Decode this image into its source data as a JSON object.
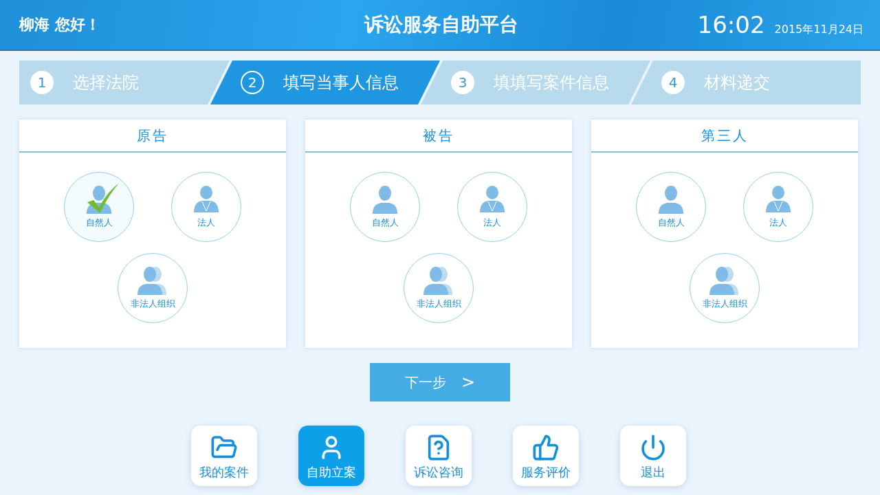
{
  "header": {
    "greeting": "柳海 您好！",
    "title": "诉讼服务自助平台",
    "time": "16:02",
    "date": "2015年11月24日"
  },
  "steps": [
    {
      "number": "1",
      "label": "选择法院",
      "selected": false
    },
    {
      "number": "2",
      "label": "填写当事人信息",
      "selected": true
    },
    {
      "number": "3",
      "label": "填填写案件信息",
      "selected": false
    },
    {
      "number": "4",
      "label": "材料递交",
      "selected": false
    }
  ],
  "parties": [
    {
      "title": "原告",
      "options": [
        {
          "kind": "person",
          "label": "自然人",
          "selected": true
        },
        {
          "kind": "corp",
          "label": "法人",
          "selected": false
        },
        {
          "kind": "org",
          "label": "非法人组织",
          "selected": false
        }
      ]
    },
    {
      "title": "被告",
      "options": [
        {
          "kind": "person",
          "label": "自然人",
          "selected": false
        },
        {
          "kind": "corp",
          "label": "法人",
          "selected": false
        },
        {
          "kind": "org",
          "label": "非法人组织",
          "selected": false
        }
      ]
    },
    {
      "title": "第三人",
      "options": [
        {
          "kind": "person",
          "label": "自然人",
          "selected": false
        },
        {
          "kind": "corp",
          "label": "法人",
          "selected": false
        },
        {
          "kind": "org",
          "label": "非法人组织",
          "selected": false
        }
      ]
    }
  ],
  "next_button": {
    "label": "下一步",
    "arrow": ">"
  },
  "nav": [
    {
      "kind": "cases",
      "label": "我的案件",
      "selected": false
    },
    {
      "kind": "file",
      "label": "自助立案",
      "selected": true
    },
    {
      "kind": "consult",
      "label": "诉讼咨询",
      "selected": false
    },
    {
      "kind": "rate",
      "label": "服务评价",
      "selected": false
    },
    {
      "kind": "exit",
      "label": "退出",
      "selected": false
    }
  ]
}
